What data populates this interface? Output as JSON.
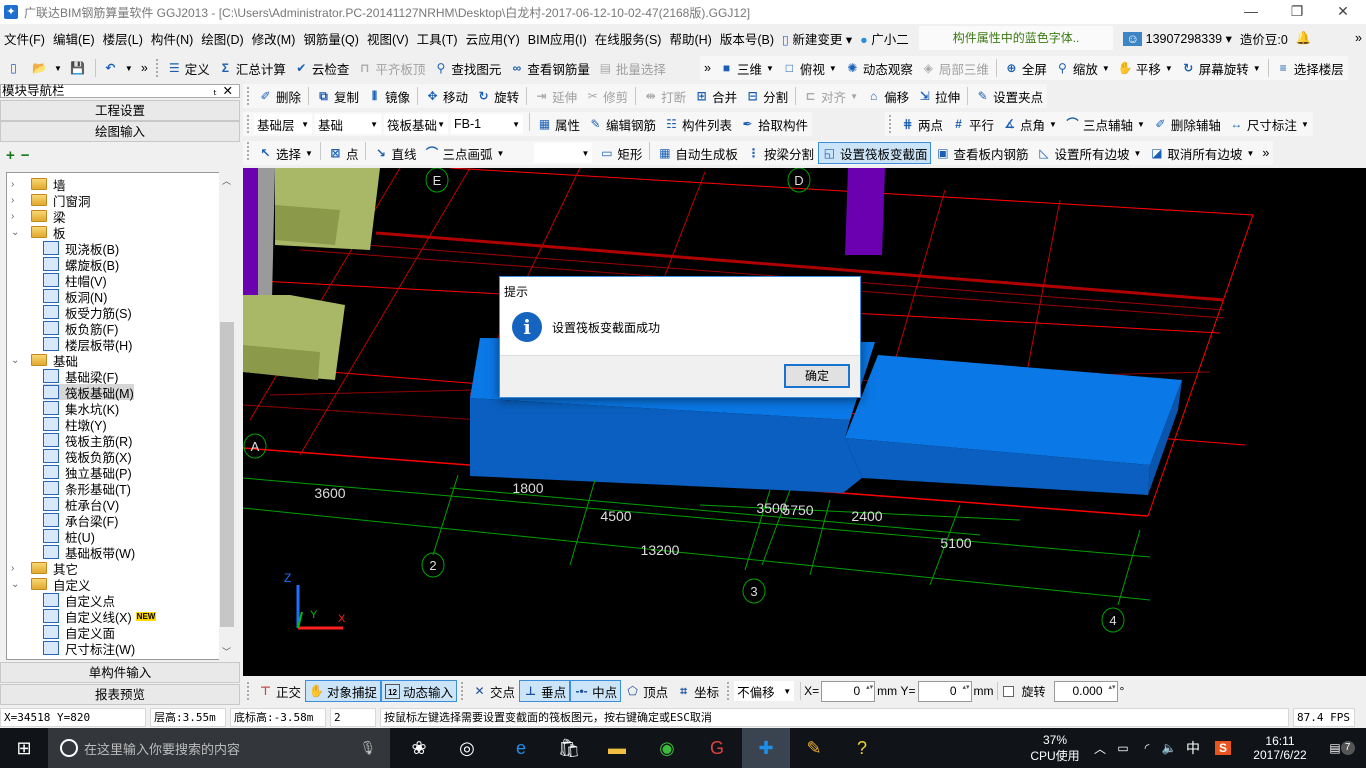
{
  "window": {
    "title": "广联达BIM钢筋算量软件 GGJ2013 - [C:\\Users\\Administrator.PC-20141127NRHM\\Desktop\\白龙村-2017-06-12-10-02-47(2168版).GGJ12]",
    "minimize": "—",
    "restore": "❐",
    "close": "✕"
  },
  "menu": {
    "items": [
      "文件(F)",
      "编辑(E)",
      "楼层(L)",
      "构件(N)",
      "绘图(D)",
      "修改(M)",
      "钢筋量(Q)",
      "视图(V)",
      "工具(T)",
      "云应用(Y)",
      "BIM应用(I)",
      "在线服务(S)",
      "帮助(H)",
      "版本号(B)"
    ],
    "new_change": "新建变更",
    "assistant": "广小二",
    "tip": "构件属性中的蓝色字体..",
    "account": "13907298339",
    "beans": "造价豆:0",
    "more": "»"
  },
  "toolbar": {
    "row1": [
      {
        "icon": "new-file",
        "name": "new-file-button"
      },
      {
        "icon": "open-folder",
        "name": "open-button",
        "dropdown": true
      },
      {
        "icon": "save",
        "name": "save-button"
      },
      {
        "sep": true
      },
      {
        "icon": "undo",
        "name": "undo-button",
        "dropdown": true
      },
      {
        "label": "»",
        "name": "more-button"
      },
      {
        "grip": true
      },
      {
        "label": "定义",
        "icon": "define",
        "name": "define-button"
      },
      {
        "label": "汇总计算",
        "icon": "sigma",
        "name": "summary-calc-button"
      },
      {
        "label": "云检查",
        "icon": "cloud-check",
        "name": "cloud-check-button"
      },
      {
        "label": "平齐板顶",
        "icon": "align-top",
        "name": "align-slab-top-button",
        "disabled": true
      },
      {
        "label": "查找图元",
        "icon": "binoculars",
        "name": "find-element-button"
      },
      {
        "label": "查看钢筋量",
        "icon": "glasses",
        "name": "view-rebar-button"
      },
      {
        "label": "批量选择",
        "icon": "batch",
        "name": "batch-select-button",
        "disabled": true
      }
    ],
    "row1b": [
      {
        "label": "»",
        "name": "more-button"
      },
      {
        "label": "三维",
        "icon": "cube",
        "name": "3d-button",
        "dropdown": true
      },
      {
        "label": "俯视",
        "icon": "cube-top",
        "name": "top-view-button",
        "dropdown": true
      },
      {
        "label": "动态观察",
        "icon": "orbit",
        "name": "orbit-button"
      },
      {
        "label": "局部三维",
        "icon": "local-3d",
        "name": "local-3d-button",
        "disabled": true
      },
      {
        "sep": true
      },
      {
        "label": "全屏",
        "icon": "fullscreen",
        "name": "fullscreen-button"
      },
      {
        "label": "缩放",
        "icon": "zoom",
        "name": "zoom-button",
        "dropdown": true
      },
      {
        "label": "平移",
        "icon": "pan-hand",
        "name": "pan-button",
        "dropdown": true
      },
      {
        "label": "屏幕旋转",
        "icon": "rotate-screen",
        "name": "screen-rotate-button",
        "dropdown": true
      },
      {
        "sep": true
      },
      {
        "label": "选择楼层",
        "icon": "floors",
        "name": "select-floor-button"
      }
    ],
    "row2": [
      {
        "grip": true
      },
      {
        "label": "删除",
        "icon": "eraser",
        "name": "delete-button"
      },
      {
        "sep": true
      },
      {
        "label": "复制",
        "icon": "copy",
        "name": "copy-button"
      },
      {
        "label": "镜像",
        "icon": "mirror",
        "name": "mirror-button"
      },
      {
        "sep": true
      },
      {
        "label": "移动",
        "icon": "move",
        "name": "move-button"
      },
      {
        "label": "旋转",
        "icon": "rotate",
        "name": "rotate-button"
      },
      {
        "sep": true
      },
      {
        "label": "延伸",
        "icon": "extend",
        "name": "extend-button",
        "disabled": true
      },
      {
        "label": "修剪",
        "icon": "trim",
        "name": "trim-button",
        "disabled": true
      },
      {
        "sep": true
      },
      {
        "label": "打断",
        "icon": "break",
        "name": "break-button",
        "disabled": true
      },
      {
        "label": "合并",
        "icon": "merge",
        "name": "merge-button"
      },
      {
        "label": "分割",
        "icon": "split",
        "name": "split-button"
      },
      {
        "sep": true
      },
      {
        "label": "对齐",
        "icon": "align",
        "name": "align-button",
        "disabled": true,
        "dropdown": true
      },
      {
        "label": "偏移",
        "icon": "offset",
        "name": "offset-button"
      },
      {
        "label": "拉伸",
        "icon": "stretch",
        "name": "stretch-button"
      },
      {
        "sep": true
      },
      {
        "label": "设置夹点",
        "icon": "grip-point",
        "name": "set-grip-button"
      }
    ],
    "row3_selects": [
      "基础层",
      "基础",
      "筏板基础",
      "FB-1"
    ],
    "row3": [
      {
        "sep": true
      },
      {
        "label": "属性",
        "icon": "properties",
        "name": "properties-button"
      },
      {
        "label": "编辑钢筋",
        "icon": "edit-rebar",
        "name": "edit-rebar-button"
      },
      {
        "label": "构件列表",
        "icon": "list",
        "name": "component-list-button"
      },
      {
        "label": "拾取构件",
        "icon": "eyedropper",
        "name": "pick-component-button"
      }
    ],
    "row3b": [
      {
        "grip": true
      },
      {
        "label": "两点",
        "icon": "two-point",
        "name": "two-point-axis-button"
      },
      {
        "label": "平行",
        "icon": "parallel",
        "name": "parallel-axis-button"
      },
      {
        "label": "点角",
        "icon": "point-angle",
        "name": "point-angle-axis-button",
        "dropdown": true
      },
      {
        "label": "三点辅轴",
        "icon": "arc-axis",
        "name": "three-point-axis-button",
        "dropdown": true
      },
      {
        "label": "删除辅轴",
        "icon": "eraser",
        "name": "delete-axis-button"
      },
      {
        "label": "尺寸标注",
        "icon": "dimension",
        "name": "dimension-button",
        "dropdown": true
      }
    ],
    "row4": [
      {
        "grip": true
      },
      {
        "label": "选择",
        "icon": "cursor",
        "name": "select-button",
        "dropdown": true
      },
      {
        "sep": true
      },
      {
        "label": "点",
        "icon": "point-box",
        "name": "point-button"
      },
      {
        "sep": true
      },
      {
        "label": "直线",
        "icon": "line",
        "name": "line-button"
      },
      {
        "label": "三点画弧",
        "icon": "arc",
        "name": "arc-button",
        "dropdown": true
      }
    ],
    "row4b": [
      {
        "label": "矩形",
        "icon": "rectangle",
        "name": "rectangle-button"
      },
      {
        "sep": true
      },
      {
        "label": "自动生成板",
        "icon": "grid",
        "name": "auto-slab-button"
      },
      {
        "label": "按梁分割",
        "icon": "split-beam",
        "name": "split-by-beam-button"
      },
      {
        "label": "设置筏板变截面",
        "icon": "section",
        "name": "set-raft-section-button",
        "active": true
      },
      {
        "label": "查看板内钢筋",
        "icon": "view-rebar",
        "name": "view-slab-rebar-button"
      },
      {
        "label": "设置所有边坡",
        "icon": "slope",
        "name": "set-all-slopes-button",
        "dropdown": true
      },
      {
        "label": "取消所有边坡",
        "icon": "slope-cancel",
        "name": "cancel-all-slopes-button",
        "dropdown": true
      },
      {
        "label": "»",
        "name": "more-button"
      }
    ]
  },
  "nav": {
    "title": "模块导航栏",
    "pin": "ₜ",
    "close": "✕",
    "project_settings": "工程设置",
    "drawing_input": "绘图输入",
    "single_input": "单构件输入",
    "report_preview": "报表预览",
    "expand": "+",
    "collapse": "−"
  },
  "tree": [
    {
      "label": "墙",
      "level": 0,
      "folder": true,
      "open": false
    },
    {
      "label": "门窗洞",
      "level": 0,
      "folder": true,
      "open": false
    },
    {
      "label": "梁",
      "level": 0,
      "folder": true,
      "open": false
    },
    {
      "label": "板",
      "level": 0,
      "folder": true,
      "open": true
    },
    {
      "label": "现浇板(B)",
      "level": 1
    },
    {
      "label": "螺旋板(B)",
      "level": 1
    },
    {
      "label": "柱帽(V)",
      "level": 1
    },
    {
      "label": "板洞(N)",
      "level": 1
    },
    {
      "label": "板受力筋(S)",
      "level": 1
    },
    {
      "label": "板负筋(F)",
      "level": 1
    },
    {
      "label": "楼层板带(H)",
      "level": 1
    },
    {
      "label": "基础",
      "level": 0,
      "folder": true,
      "open": true
    },
    {
      "label": "基础梁(F)",
      "level": 1
    },
    {
      "label": "筏板基础(M)",
      "level": 1,
      "selected": true
    },
    {
      "label": "集水坑(K)",
      "level": 1
    },
    {
      "label": "柱墩(Y)",
      "level": 1
    },
    {
      "label": "筏板主筋(R)",
      "level": 1
    },
    {
      "label": "筏板负筋(X)",
      "level": 1
    },
    {
      "label": "独立基础(P)",
      "level": 1
    },
    {
      "label": "条形基础(T)",
      "level": 1
    },
    {
      "label": "桩承台(V)",
      "level": 1
    },
    {
      "label": "承台梁(F)",
      "level": 1
    },
    {
      "label": "桩(U)",
      "level": 1
    },
    {
      "label": "基础板带(W)",
      "level": 1
    },
    {
      "label": "其它",
      "level": 0,
      "folder": true,
      "open": false
    },
    {
      "label": "自定义",
      "level": 0,
      "folder": true,
      "open": true
    },
    {
      "label": "自定义点",
      "level": 1
    },
    {
      "label": "自定义线(X)",
      "level": 1,
      "badge": "NEW"
    },
    {
      "label": "自定义面",
      "level": 1
    },
    {
      "label": "尺寸标注(W)",
      "level": 1
    }
  ],
  "viewport": {
    "axes": [
      "E",
      "D",
      "A",
      "2",
      "3",
      "4"
    ],
    "dimensions": [
      "3600",
      "1800",
      "4500",
      "13200",
      "3500",
      "5750",
      "2400",
      "5100"
    ],
    "coord_axes": {
      "x": "X",
      "y": "Y",
      "z": "Z"
    },
    "colors": {
      "raft": "#0a78e6",
      "raft_front": "#0a5fc0",
      "column": "#6a00b0",
      "footing": "#a8b866",
      "grid_red": "#ff0000",
      "dim_green": "#00a000"
    }
  },
  "dialog": {
    "title": "提示",
    "icon": "info-icon",
    "message": "设置筏板变截面成功",
    "ok": "确定"
  },
  "bottombar": {
    "ortho": "正交",
    "snap": "对象捕捉",
    "dynamic_input": "动态输入",
    "intersection": "交点",
    "perpendicular": "垂点",
    "midpoint": "中点",
    "vertex": "顶点",
    "coordinate": "坐标",
    "offset_mode": "不偏移",
    "x_label": "X=",
    "x_value": "0",
    "y_label": "Y=",
    "y_value": "0",
    "unit": "mm",
    "rotate_label": "旋转",
    "rotate_value": "0.000",
    "degree": "°"
  },
  "status": {
    "coords": "X=34518 Y=820",
    "floor_height": "层高:3.55m",
    "bottom_elev": "底标高:-3.58m",
    "count": "2",
    "message": "按鼠标左键选择需要设置变截面的筏板图元，按右键确定或ESC取消",
    "fps": "87.4 FPS"
  },
  "taskbar": {
    "search_placeholder": "在这里输入你要搜索的内容",
    "cpu_percent": "37%",
    "cpu_label": "CPU使用",
    "ime": "中",
    "time": "16:11",
    "date": "2017/6/22",
    "notifications": "7"
  }
}
